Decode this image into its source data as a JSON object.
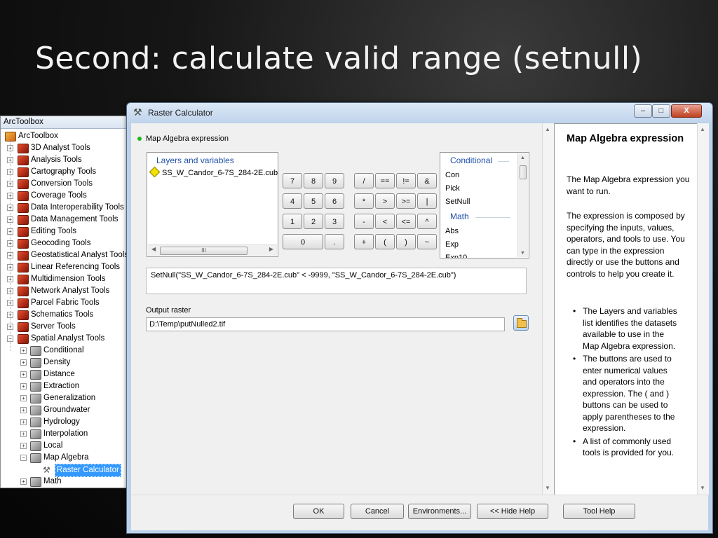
{
  "slide": {
    "title": "Second: calculate valid range (setnull)"
  },
  "toolbox": {
    "header": "ArcToolbox",
    "root": "ArcToolbox",
    "items": [
      "3D Analyst Tools",
      "Analysis Tools",
      "Cartography Tools",
      "Conversion Tools",
      "Coverage Tools",
      "Data Interoperability Tools",
      "Data Management Tools",
      "Editing Tools",
      "Geocoding Tools",
      "Geostatistical Analyst Tools",
      "Linear Referencing Tools",
      "Multidimension Tools",
      "Network Analyst Tools",
      "Parcel Fabric Tools",
      "Schematics Tools",
      "Server Tools",
      "Spatial Analyst Tools"
    ],
    "spatial_children": [
      "Conditional",
      "Density",
      "Distance",
      "Extraction",
      "Generalization",
      "Groundwater",
      "Hydrology",
      "Interpolation",
      "Local",
      "Map Algebra"
    ],
    "map_algebra_child": "Raster Calculator",
    "after": "Math"
  },
  "window": {
    "title": "Raster Calculator",
    "controls": {
      "minimize": "–",
      "maximize": "□",
      "close": "X"
    }
  },
  "calc": {
    "section_label": "Map Algebra expression",
    "layers_header": "Layers and variables",
    "layer_item": "SS_W_Candor_6-7S_284-2E.cub",
    "hscroll_thumb": "III",
    "buttons": [
      "7",
      "8",
      "9",
      "/",
      "==",
      "!=",
      "&",
      "4",
      "5",
      "6",
      "*",
      ">",
      ">=",
      "|",
      "1",
      "2",
      "3",
      "-",
      "<",
      "<=",
      "^",
      "0",
      ".",
      "+",
      "(",
      ")",
      "~"
    ],
    "tools_group1": "Conditional",
    "tools1": [
      "Con",
      "Pick",
      "SetNull"
    ],
    "tools_group2": "Math",
    "tools2": [
      "Abs",
      "Exp",
      "Exp10"
    ],
    "expression": "SetNull(\"SS_W_Candor_6-7S_284-2E.cub\" < -9999, \"SS_W_Candor_6-7S_284-2E.cub\")",
    "output_label": "Output raster",
    "output_value": "D:\\Temp\\putNulled2.tif"
  },
  "help": {
    "title": "Map Algebra expression",
    "p1": "The Map Algebra expression you want to run.",
    "p2": "The expression is composed by specifying the inputs, values, operators, and tools to use. You can type in the expression directly or use the buttons and controls to help you create it.",
    "bullets": [
      "The Layers and variables list identifies the datasets available to use in the Map Algebra expression.",
      "The buttons are used to enter numerical values and operators into the expression. The ( and ) buttons can be used to apply parentheses to the expression.",
      "A list of commonly used tools is provided for you."
    ]
  },
  "footer": {
    "ok": "OK",
    "cancel": "Cancel",
    "environments": "Environments...",
    "hide_help": "<< Hide Help",
    "tool_help": "Tool Help"
  }
}
